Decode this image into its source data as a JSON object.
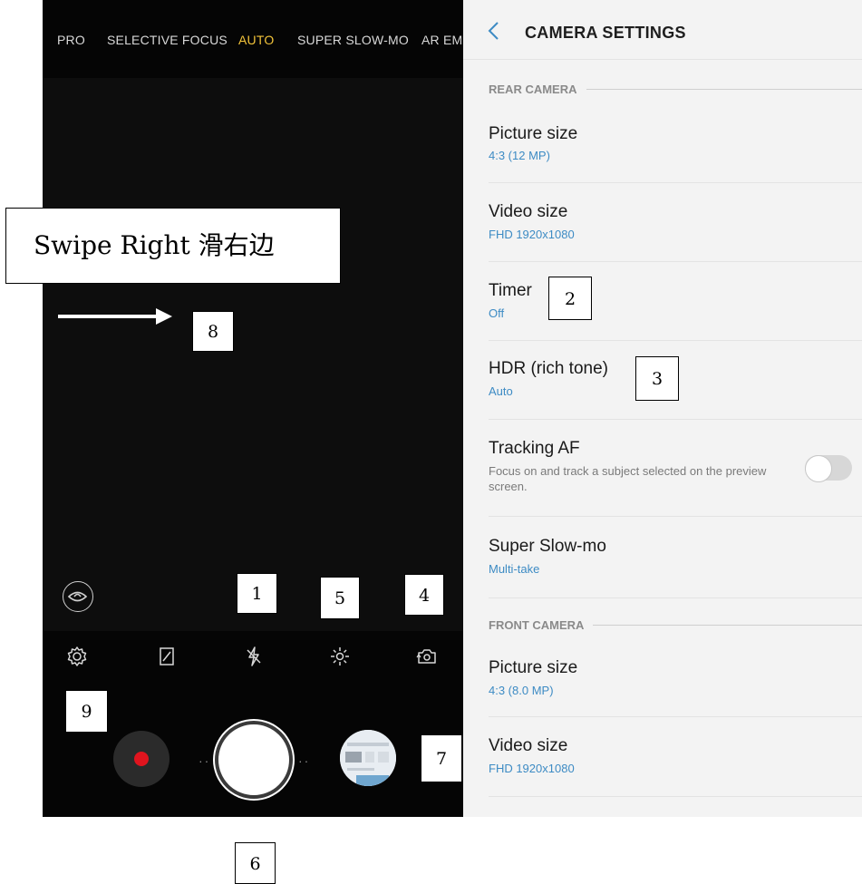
{
  "camera": {
    "modes": [
      {
        "label": "PRO",
        "active": false
      },
      {
        "label": "SELECTIVE FOCUS",
        "active": false
      },
      {
        "label": "AUTO",
        "active": true
      },
      {
        "label": "SUPER SLOW-MO",
        "active": false
      },
      {
        "label": "AR EM",
        "active": false
      }
    ],
    "toolbar_icons": [
      "gear-icon",
      "aspect-ratio-icon",
      "flash-off-icon",
      "filter-effects-icon",
      "switch-camera-icon"
    ],
    "bottom_controls": [
      "bixby-vision-icon",
      "record-button",
      "shutter-button",
      "gallery-thumbnail"
    ],
    "colors": {
      "active_mode": "#f3c43a",
      "record": "#e0141e",
      "background": "#0a0a0a"
    }
  },
  "settings": {
    "title": "CAMERA SETTINGS",
    "sections": [
      {
        "header": "REAR CAMERA",
        "rows": [
          {
            "title": "Picture size",
            "value": "4:3 (12 MP)"
          },
          {
            "title": "Video size",
            "value": "FHD 1920x1080"
          },
          {
            "title": "Timer",
            "value": "Off"
          },
          {
            "title": "HDR (rich tone)",
            "value": "Auto"
          },
          {
            "title": "Tracking AF",
            "description": "Focus on and track a subject selected on the preview screen.",
            "toggle": false
          },
          {
            "title": "Super Slow-mo",
            "value": "Multi-take"
          }
        ]
      },
      {
        "header": "FRONT CAMERA",
        "rows": [
          {
            "title": "Picture size",
            "value": "4:3 (8.0 MP)"
          },
          {
            "title": "Video size",
            "value": "FHD 1920x1080"
          }
        ]
      }
    ],
    "colors": {
      "value_text": "#3d8bc4",
      "background": "#f3f3f3"
    }
  },
  "annotations": {
    "swipe_label": "Swipe Right 滑右边",
    "callouts": [
      "1",
      "2",
      "3",
      "4",
      "5",
      "6",
      "7",
      "8",
      "9"
    ]
  }
}
